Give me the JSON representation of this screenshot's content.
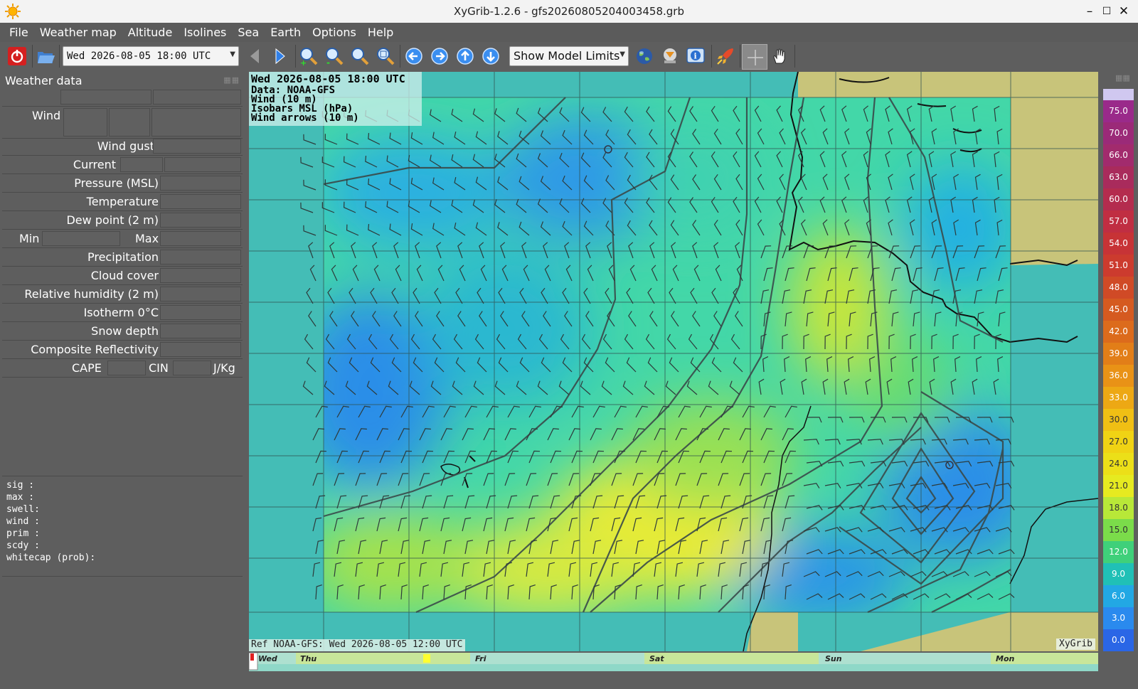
{
  "window": {
    "title": "XyGrib-1.2.6 - gfs20260805204003458.grb",
    "icon": "sun-icon",
    "controls": [
      "minimize-icon",
      "maximize-icon",
      "close-icon"
    ]
  },
  "menu": [
    "File",
    "Weather map",
    "Altitude",
    "Isolines",
    "Sea",
    "Earth",
    "Options",
    "Help"
  ],
  "toolbar": {
    "date_select": "Wed 2026-08-05 18:00 UTC",
    "model_select": "Show Model Limits",
    "icons": [
      "power-icon",
      "open-file-icon",
      "previous-icon",
      "next-icon",
      "zoom-in-icon",
      "zoom-out-icon",
      "zoom-area-icon",
      "zoom-fit-icon",
      "pan-left-icon",
      "pan-right-icon",
      "pan-up-icon",
      "pan-down-icon",
      "globe-icon",
      "download-icon",
      "info-icon",
      "rocket-icon",
      "crosshair-icon",
      "hand-icon"
    ]
  },
  "panel": {
    "title": "Weather data",
    "rows": {
      "wind": "Wind",
      "wind_gust": "Wind gust",
      "current": "Current",
      "pressure": "Pressure (MSL)",
      "temperature": "Temperature",
      "dew_point": "Dew point (2 m)",
      "min": "Min",
      "max": "Max",
      "precipitation": "Precipitation",
      "cloud_cover": "Cloud cover",
      "humidity": "Relative humidity (2 m)",
      "isotherm": "Isotherm 0°C",
      "snow_depth": "Snow depth",
      "reflectivity": "Composite Reflectivity",
      "cape": "CAPE",
      "cin": "CIN",
      "jkg": "J/Kg"
    },
    "wave_lines": [
      "sig  :",
      "max  :",
      "swell:",
      "wind :",
      "prim :",
      "scdy :",
      "whitecap (prob):"
    ]
  },
  "map": {
    "info_lines": [
      "Wed 2026-08-05 18:00 UTC",
      "Data: NOAA-GFS",
      "Wind (10 m)",
      "Isobars MSL (hPa)",
      "Wind arrows (10 m)"
    ],
    "ref_text": "Ref NOAA-GFS: Wed 2026-08-05 12:00 UTC",
    "brand": "XyGrib"
  },
  "timeline": {
    "days": [
      "Wed",
      "Thu",
      "Fri",
      "Sat",
      "Sun",
      "Mon"
    ],
    "current_position": 0.0
  },
  "color_scale": {
    "values": [
      "75.0",
      "70.0",
      "66.0",
      "63.0",
      "60.0",
      "57.0",
      "54.0",
      "51.0",
      "48.0",
      "45.0",
      "42.0",
      "39.0",
      "36.0",
      "33.0",
      "30.0",
      "27.0",
      "24.0",
      "21.0",
      "18.0",
      "15.0",
      "12.0",
      "9.0",
      "6.0",
      "3.0",
      "0.0"
    ],
    "colors": [
      "#9a2a8a",
      "#9b2a78",
      "#a22b6d",
      "#a92b5c",
      "#b42c4e",
      "#c02e42",
      "#c73336",
      "#cc3b2e",
      "#d04a26",
      "#d55a20",
      "#dc6b1c",
      "#e27e18",
      "#e99216",
      "#eda814",
      "#f0bf14",
      "#f0d314",
      "#ecdf18",
      "#e6ea20",
      "#b8e838",
      "#7bdc4a",
      "#3fd07a",
      "#20c0b6",
      "#22a8e4",
      "#2a8aee",
      "#2a66e6"
    ]
  }
}
